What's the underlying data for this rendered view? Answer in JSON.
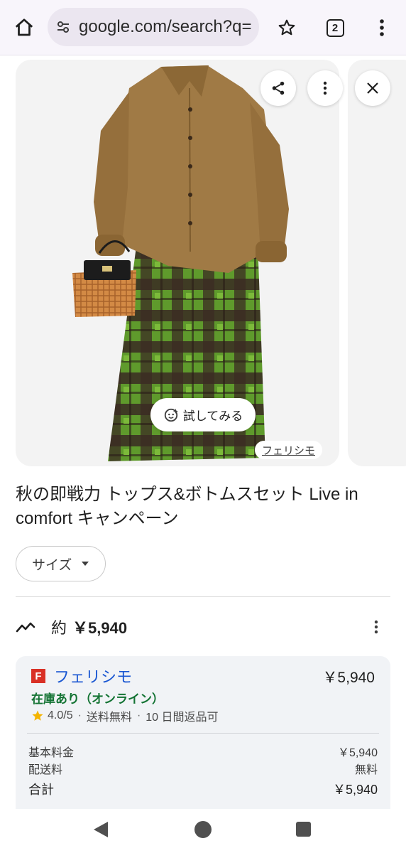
{
  "browser": {
    "url": "google.com/search?q=",
    "tab_count": "2"
  },
  "image": {
    "try_on_label": "試してみる",
    "source_label": "フェリシモ"
  },
  "product": {
    "title": "秋の即戦力 トップス&ボトムスセット Live in comfort キャンペーン",
    "size_chip": "サイズ",
    "approx_label": "約",
    "approx_price": "￥5,940"
  },
  "offer": {
    "merchant_logo": "F",
    "merchant_name": "フェリシモ",
    "price": "￥5,940",
    "stock": "在庫あり（オンライン）",
    "rating": "4.0/5",
    "shipping": "送料無料",
    "returns": "10 日間返品可",
    "rating_value": 4.0,
    "fees": [
      {
        "label": "基本料金",
        "value": "￥5,940"
      },
      {
        "label": "配送料",
        "value": "無料"
      }
    ],
    "total_label": "合計",
    "total_value": "￥5,940"
  },
  "colors": {
    "link_blue": "#1a57d2",
    "stock_green": "#137333",
    "merchant_red": "#d93025",
    "star_yellow": "#f4b400"
  },
  "icons": [
    "home-icon",
    "tune-icon",
    "star-outline-icon",
    "tab-switcher-icon",
    "kebab-menu-icon",
    "share-icon",
    "close-icon",
    "try-on-sparkle-icon",
    "trend-icon",
    "star-icon",
    "back-nav-icon",
    "home-nav-icon",
    "recents-nav-icon"
  ]
}
